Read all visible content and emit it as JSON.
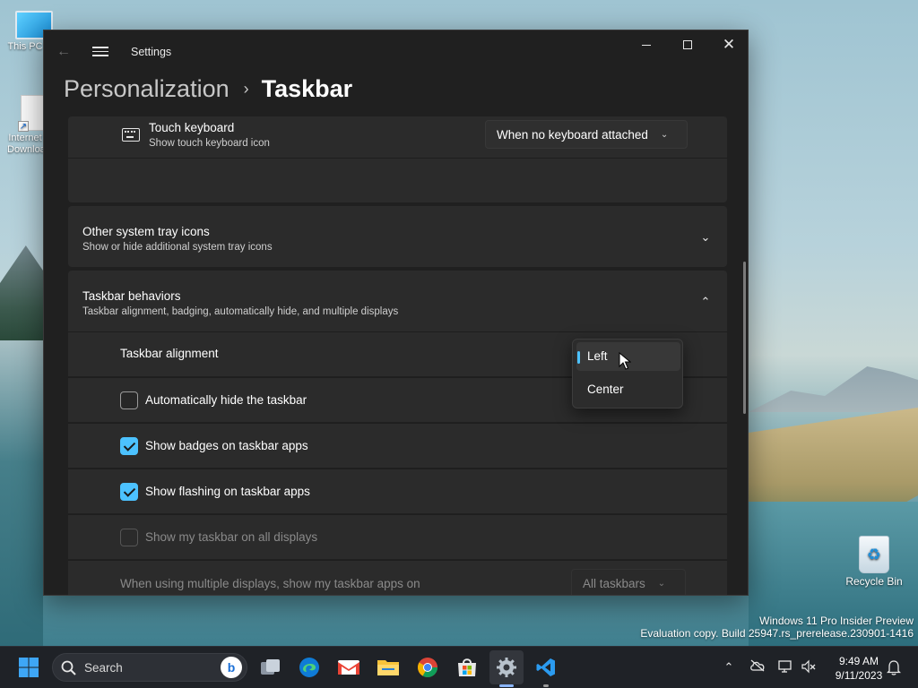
{
  "desktop": {
    "icons": [
      {
        "label": "This PC"
      },
      {
        "label": "Internet Downloads"
      },
      {
        "label": "Recycle Bin"
      }
    ],
    "watermark_line1": "Windows 11 Pro Insider Preview",
    "watermark_line2": "Evaluation copy. Build 25947.rs_prerelease.230901-1416"
  },
  "window": {
    "title": "Settings",
    "breadcrumb_parent": "Personalization",
    "breadcrumb_current": "Taskbar"
  },
  "touch_keyboard": {
    "title": "Touch keyboard",
    "subtitle": "Show touch keyboard icon",
    "dropdown_value": "When no keyboard attached"
  },
  "other_tray": {
    "title": "Other system tray icons",
    "subtitle": "Show or hide additional system tray icons"
  },
  "behaviors": {
    "title": "Taskbar behaviors",
    "subtitle": "Taskbar alignment, badging, automatically hide, and multiple displays",
    "alignment_label": "Taskbar alignment",
    "alignment_options": [
      "Left",
      "Center"
    ],
    "alignment_selected": "Left",
    "auto_hide_label": "Automatically hide the taskbar",
    "auto_hide_checked": false,
    "badges_label": "Show badges on taskbar apps",
    "badges_checked": true,
    "flashing_label": "Show flashing on taskbar apps",
    "flashing_checked": true,
    "all_displays_label": "Show my taskbar on all displays",
    "all_displays_checked": false,
    "multi_display_label": "When using multiple displays, show my taskbar apps on",
    "multi_display_value": "All taskbars"
  },
  "taskbar": {
    "search_placeholder": "Search",
    "apps": [
      "Start",
      "Task View",
      "Microsoft Edge",
      "Gmail",
      "File Explorer",
      "Google Chrome",
      "Microsoft Store",
      "Settings",
      "Visual Studio Code"
    ],
    "time": "9:49 AM",
    "date": "9/11/2023"
  },
  "colors": {
    "accent": "#4cc2ff",
    "window_bg": "#202020",
    "card_bg": "#2b2b2b",
    "taskbar_bg": "#1f2227"
  }
}
